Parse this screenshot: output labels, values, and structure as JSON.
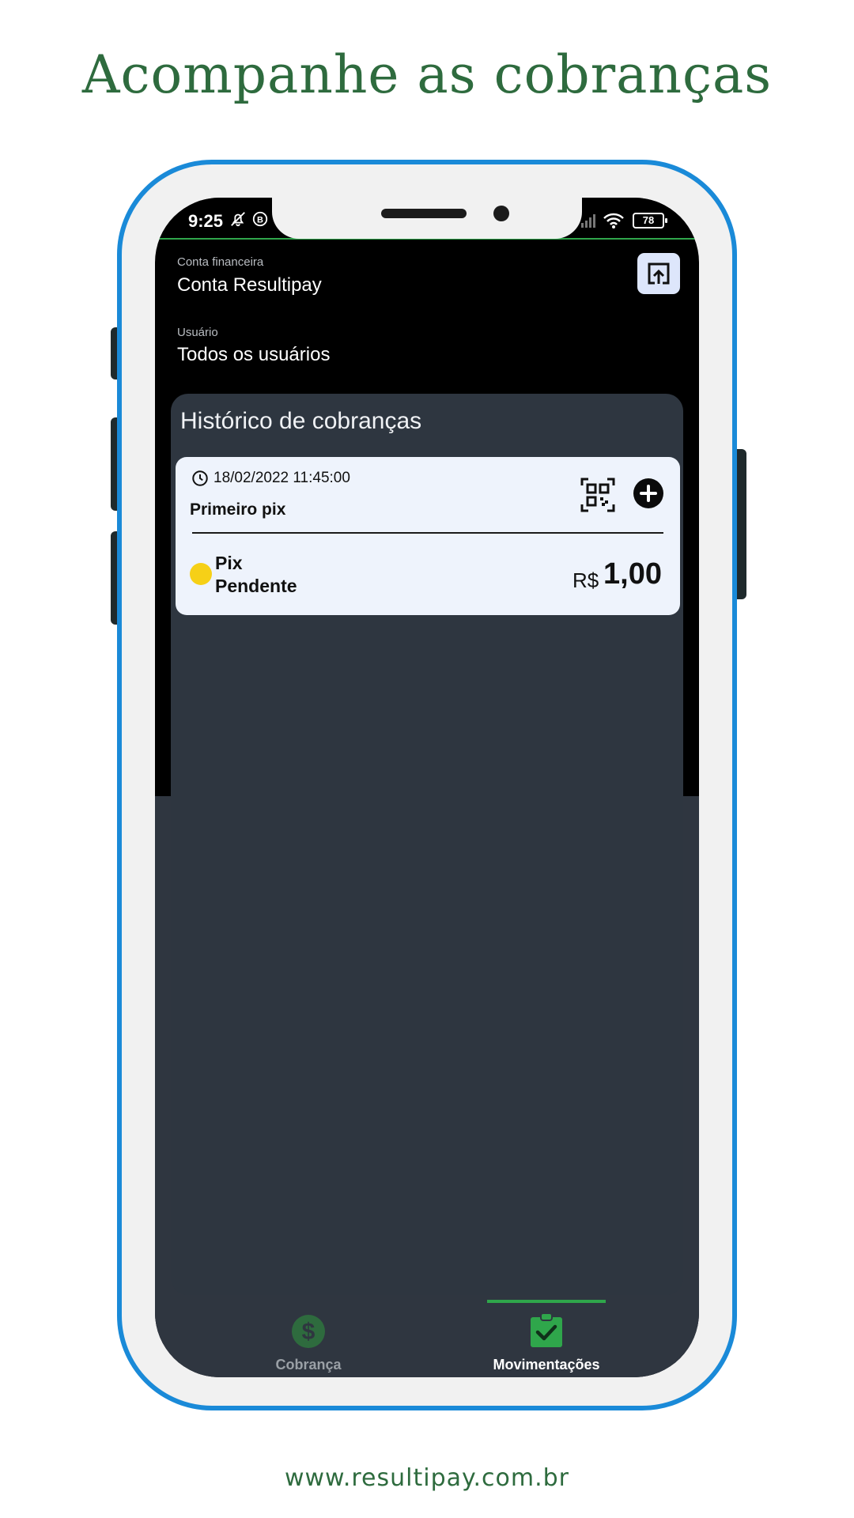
{
  "promo": {
    "headline": "Acompanhe as cobranças",
    "website": "www.resultipay.com.br"
  },
  "status_bar": {
    "time": "9:25",
    "battery": "78",
    "icons": [
      "bell-off-icon",
      "b-circle-icon",
      "signal-icon",
      "wifi-icon",
      "battery-icon"
    ]
  },
  "account": {
    "label": "Conta financeira",
    "value": "Conta Resultipay",
    "share_icon": "share-export-icon"
  },
  "user": {
    "label": "Usuário",
    "value": "Todos os usuários"
  },
  "history": {
    "title": "Histórico de cobranças",
    "items": [
      {
        "datetime": "18/02/2022 11:45:00",
        "title": "Primeiro pix",
        "method": "Pix",
        "status": "Pendente",
        "status_color": "#f6d017",
        "currency": "R$",
        "amount": "1,00"
      }
    ]
  },
  "bottom_nav": {
    "items": [
      {
        "label": "Cobrança",
        "icon": "dollar-circle-icon",
        "active": false
      },
      {
        "label": "Movimentações",
        "icon": "clipboard-check-icon",
        "active": true
      }
    ]
  },
  "colors": {
    "brand_green": "#2e6b3e",
    "accent_green": "#2fa64b",
    "frame_blue": "#1a8ad8",
    "panel_dark": "#2f3640",
    "card_light": "#eef3fc",
    "pending_yellow": "#f6d017"
  }
}
